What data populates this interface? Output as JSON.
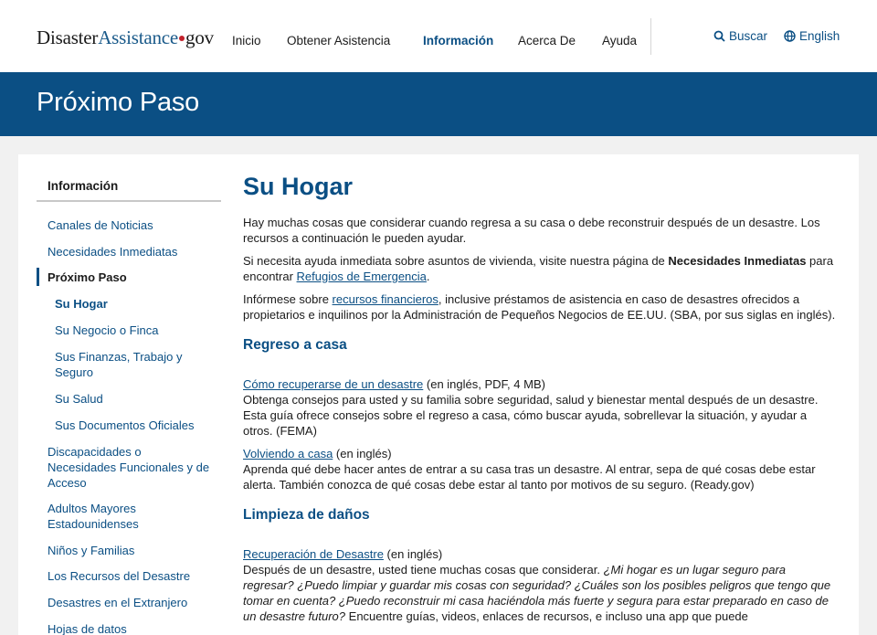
{
  "header": {
    "logo": {
      "part1": "Disaster",
      "part2": "Assistance",
      "part3": "gov"
    },
    "nav": [
      "Inicio",
      "Obtener Asistencia",
      "Información",
      "Acerca De",
      "Ayuda"
    ],
    "active_nav": "Información",
    "search_label": "Buscar",
    "language_label": "English"
  },
  "banner": {
    "title": "Próximo Paso"
  },
  "sidebar": {
    "heading": "Información",
    "items": [
      "Canales de Noticias",
      "Necesidades Inmediatas",
      "Próximo Paso",
      "Su Hogar",
      "Su Negocio o Finca",
      "Sus Finanzas, Trabajo y Seguro",
      "Su Salud",
      "Sus Documentos Oficiales",
      "Discapacidades o Necesidades Funcionales y de Acceso",
      "Adultos Mayores Estadounidenses",
      "Niños y Familias",
      "Los Recursos del Desastre",
      "Desastres en el Extranjero",
      "Hojas de datos"
    ]
  },
  "main": {
    "title": "Su Hogar",
    "intro": "Hay muchas cosas que considerar cuando regresa a su casa o debe reconstruir después de un desastre. Los recursos a continuación le pueden ayudar.",
    "p2_before": "Si necesita ayuda inmediata sobre asuntos de vivienda, visite nuestra página de ",
    "p2_bold": "Necesidades Inmediatas",
    "p2_mid": " para encontrar ",
    "p2_link": "Refugios de Emergencia",
    "p2_end": ".",
    "p3_before": "Infórmese sobre ",
    "p3_link": "recursos financieros",
    "p3_after": ", inclusive préstamos de asistencia en caso de desastres ofrecidos a propietarios e inquilinos por la Administración de Pequeños Negocios de EE.UU. (SBA, por sus siglas en inglés).",
    "section1": "Regreso a casa",
    "r1_link": "Cómo recuperarse de un desastre",
    "r1_note": " (en inglés, PDF, 4 MB)",
    "r1_desc": "Obtenga consejos para usted y su familia sobre seguridad, salud y bienestar mental después de un desastre. Esta guía ofrece consejos sobre el regreso a casa, cómo buscar ayuda, sobrellevar la situación, y ayudar a otros. (FEMA)",
    "r2_link": "Volviendo a casa",
    "r2_note": " (en inglés)",
    "r2_desc": "Aprenda qué debe hacer antes de entrar a su casa tras un desastre. Al entrar, sepa de qué cosas debe estar alerta. También conozca de qué cosas debe estar al tanto por motivos de su seguro. (Ready.gov)",
    "section2": "Limpieza de daños",
    "r3_link": "Recuperación de Desastre",
    "r3_note": " (en inglés)",
    "r3_desc_plain": "Después de un desastre, usted tiene muchas cosas que considerar. ",
    "r3_desc_italic": "¿Mi hogar es un lugar seguro para regresar? ¿Puedo limpiar y guardar mis cosas con seguridad? ¿Cuáles son los posibles peligros que tengo que tomar en cuenta? ¿Puedo reconstruir mi casa haciéndola más fuerte y segura para estar preparado en caso de un desastre futuro?",
    "r3_desc_tail": " Encuentre guías, videos, enlaces de recursos, e incluso una app que puede"
  }
}
